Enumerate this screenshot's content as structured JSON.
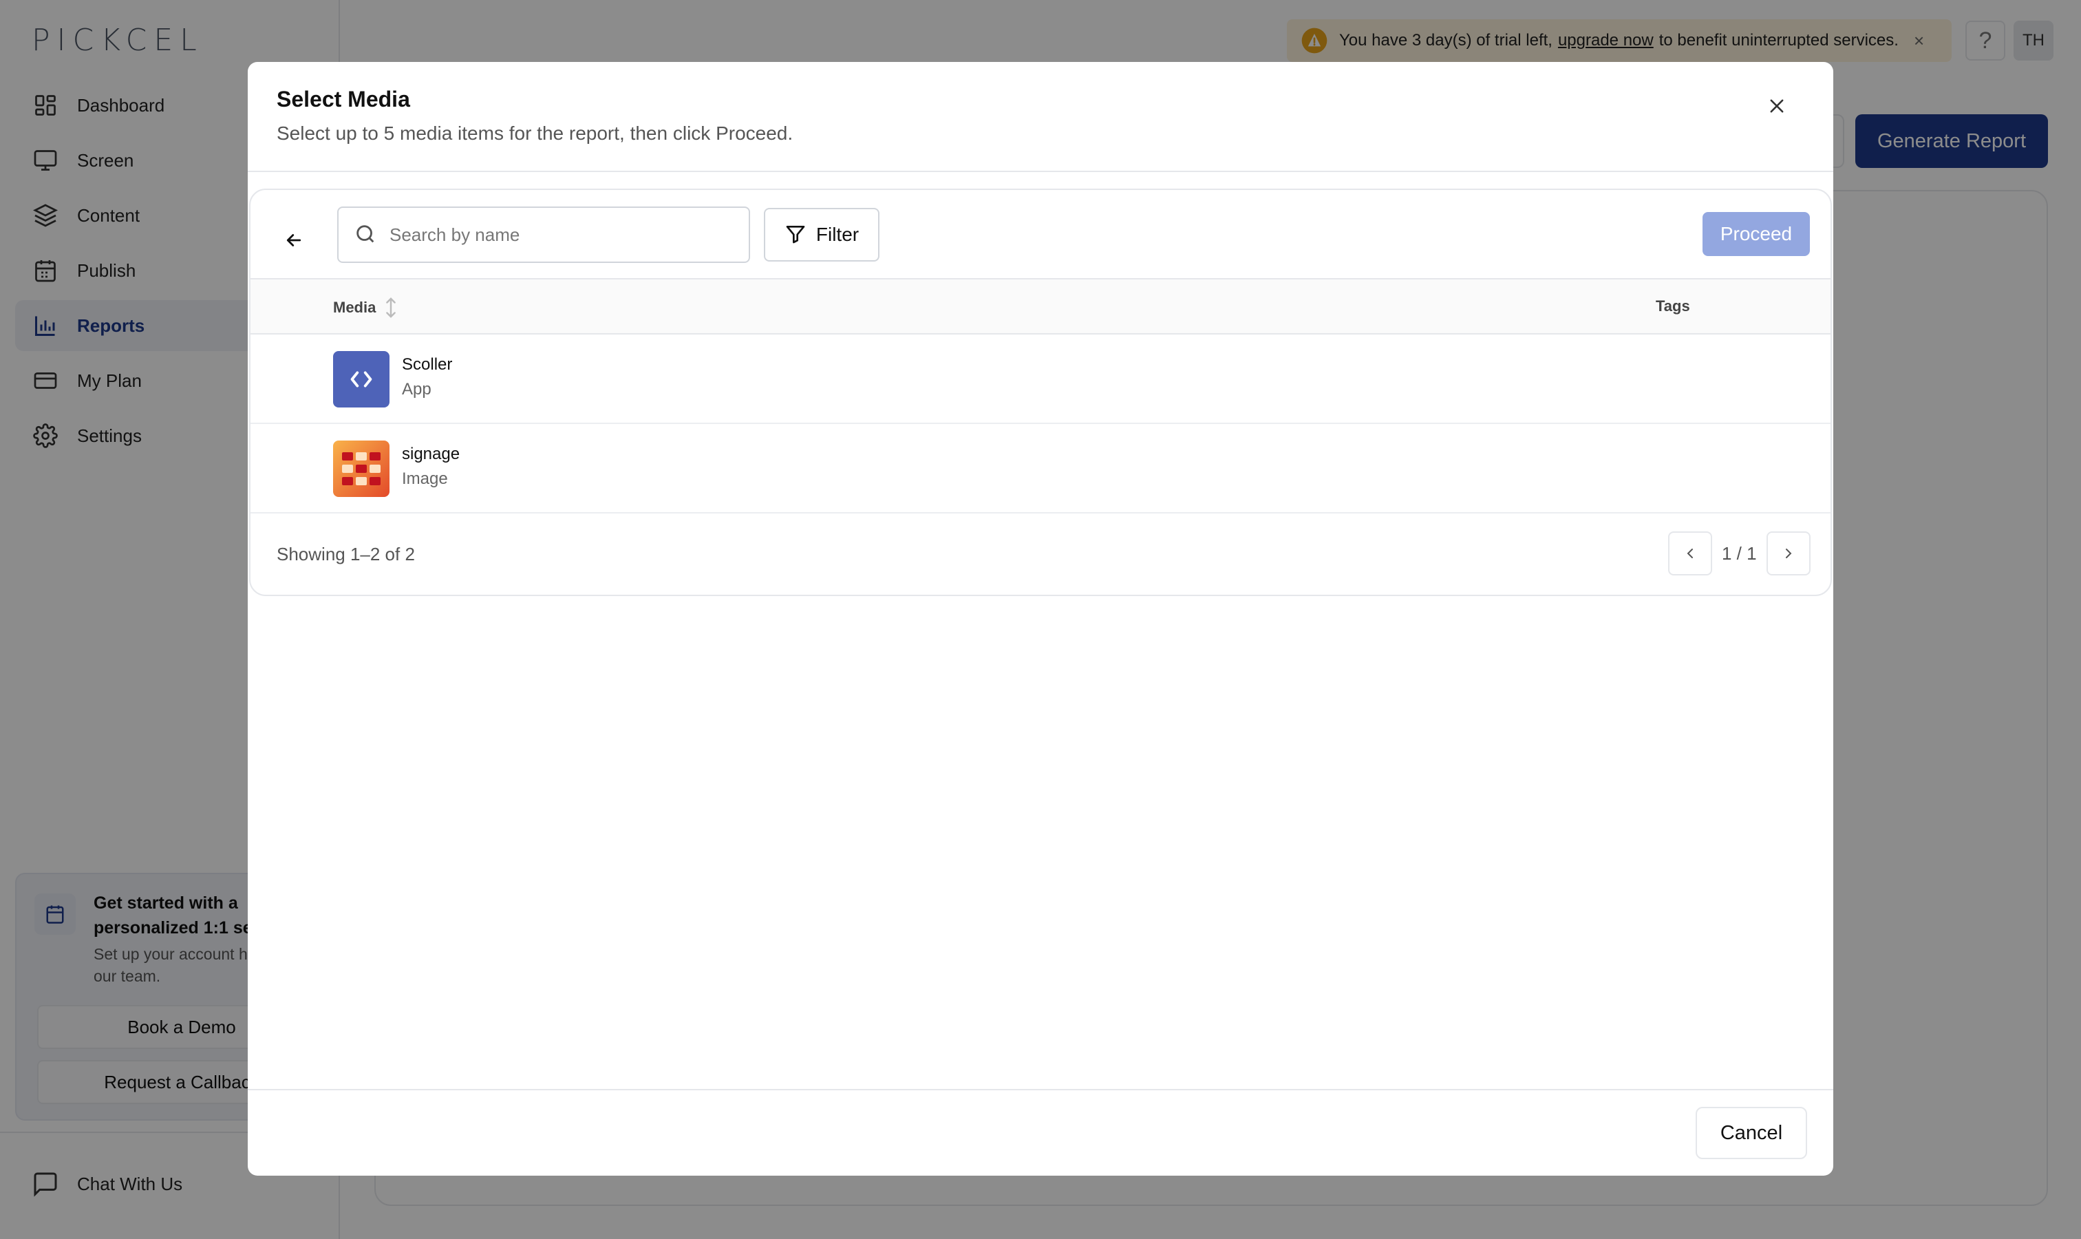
{
  "app": {
    "logo_text": "PICKCEL"
  },
  "sidebar": {
    "items": [
      {
        "label": "Dashboard",
        "icon": "dashboard-icon"
      },
      {
        "label": "Screen",
        "icon": "monitor-icon"
      },
      {
        "label": "Content",
        "icon": "layers-icon"
      },
      {
        "label": "Publish",
        "icon": "calendar-icon"
      },
      {
        "label": "Reports",
        "icon": "bar-chart-icon",
        "active": true
      },
      {
        "label": "My Plan",
        "icon": "credit-card-icon"
      },
      {
        "label": "Settings",
        "icon": "gear-icon"
      }
    ],
    "promo": {
      "title": "Get started with a personalized 1:1 se",
      "text": "Set up your account help from our team.",
      "book_demo": "Book a Demo",
      "request_callback": "Request a Callback"
    },
    "chat": "Chat With Us"
  },
  "topbar": {
    "trial_prefix": "You have 3 day(s) of trial left,",
    "trial_link": "upgrade now",
    "trial_suffix": "to benefit uninterrupted services.",
    "close": "×",
    "help": "?",
    "avatar": "TH"
  },
  "main": {
    "generate_report": "Generate Report"
  },
  "modal": {
    "title": "Select Media",
    "subtitle": "Select up to 5 media items for the report, then click Proceed.",
    "search_placeholder": "Search by name",
    "filter_label": "Filter",
    "proceed_label": "Proceed",
    "columns": {
      "media": "Media",
      "tags": "Tags"
    },
    "rows": [
      {
        "name": "Scoller",
        "type": "App"
      },
      {
        "name": "signage",
        "type": "Image"
      }
    ],
    "showing": "Showing 1–2 of 2",
    "page_indicator": "1 / 1",
    "cancel_label": "Cancel"
  },
  "colors": {
    "accent": "#1e3a8a",
    "proceed_disabled": "#93a7e0",
    "trial_bg": "#fdf3dc",
    "warning": "#e8a21a"
  }
}
